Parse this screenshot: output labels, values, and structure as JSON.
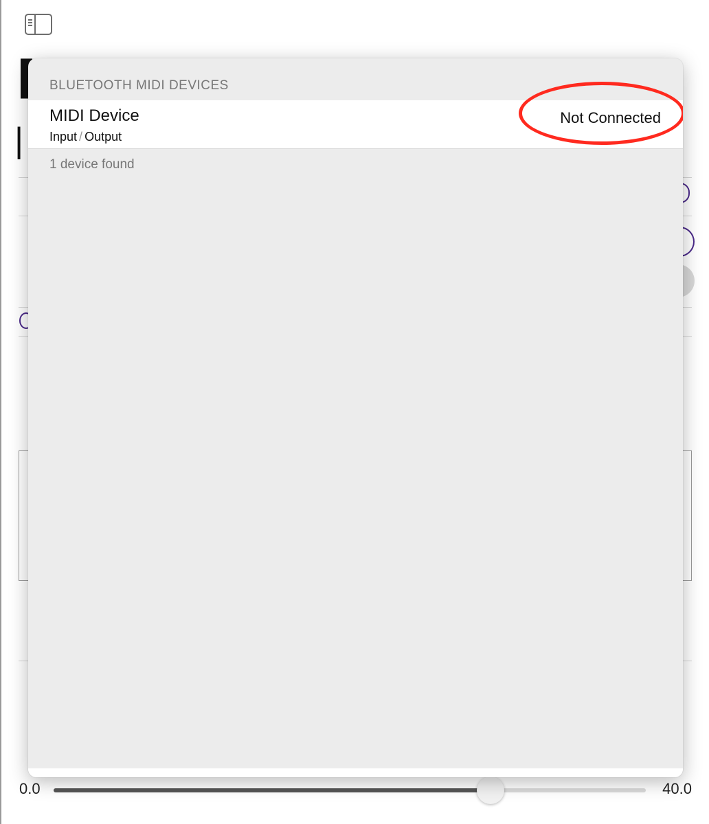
{
  "toolbar": {
    "sidebar_icon": "sidebar-toggle-icon"
  },
  "popover": {
    "section_title": "BLUETOOTH MIDI DEVICES",
    "devices": [
      {
        "name": "MIDI Device",
        "input_label": "Input",
        "separator": "/",
        "output_label": "Output",
        "status": "Not Connected"
      }
    ],
    "footer": "1 device found"
  },
  "slider": {
    "min_label": "0.0",
    "max_label": "40.0",
    "value_fraction": 0.738
  },
  "colors": {
    "accent_purple": "#4b2a8a",
    "highlight_red": "#ff2a1f"
  }
}
